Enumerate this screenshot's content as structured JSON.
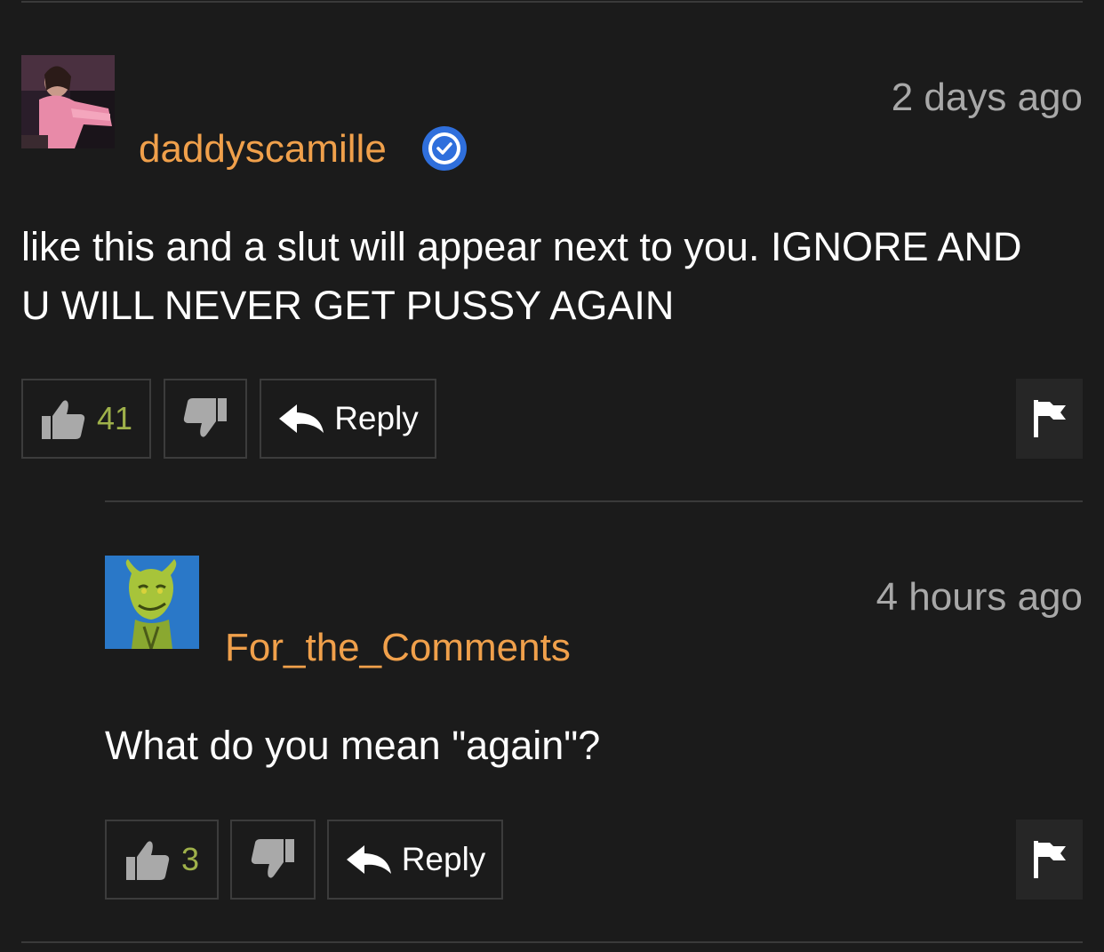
{
  "comments": [
    {
      "username": "daddyscamille",
      "verified": true,
      "timestamp": "2 days ago",
      "text": "like this and a slut will appear next to you. IGNORE AND U WILL NEVER GET PUSSY AGAIN",
      "likes": "41",
      "reply_label": "Reply",
      "icons": [
        "thumbs-up-icon",
        "thumbs-down-icon",
        "reply-arrow-icon",
        "flag-icon",
        "verified-badge-icon"
      ]
    },
    {
      "username": "For_the_Comments",
      "verified": false,
      "timestamp": "4 hours ago",
      "text": "What do you mean \"again\"?",
      "likes": "3",
      "reply_label": "Reply",
      "icons": [
        "thumbs-up-icon",
        "thumbs-down-icon",
        "reply-arrow-icon",
        "flag-icon"
      ]
    }
  ],
  "colors": {
    "background": "#1b1b1b",
    "username": "#f0a04b",
    "like_count": "#9fb14a",
    "timestamp": "#a8a8a8",
    "verified_badge": "#2f6fdc",
    "divider": "#3a3a3a"
  }
}
